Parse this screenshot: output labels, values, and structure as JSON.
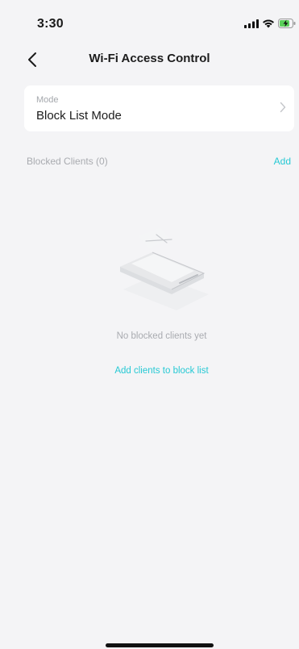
{
  "status_bar": {
    "time": "3:30",
    "icons": [
      "cellular-signal-icon",
      "wifi-icon",
      "battery-charging-icon"
    ]
  },
  "nav": {
    "title": "Wi-Fi Access Control",
    "back_icon": "chevron-left-icon"
  },
  "mode": {
    "label": "Mode",
    "value": "Block List Mode",
    "chevron_icon": "chevron-right-icon"
  },
  "blocked_clients": {
    "header": "Blocked Clients (0)",
    "add_label": "Add",
    "empty_text": "No blocked clients yet",
    "empty_action": "Add clients to block list",
    "illustration_icon": "empty-list-illustration"
  },
  "colors": {
    "background": "#f4f4f6",
    "card": "#ffffff",
    "accent": "#26c9d4",
    "muted_text": "#a9abb0",
    "primary_text": "#1c1c1c"
  }
}
